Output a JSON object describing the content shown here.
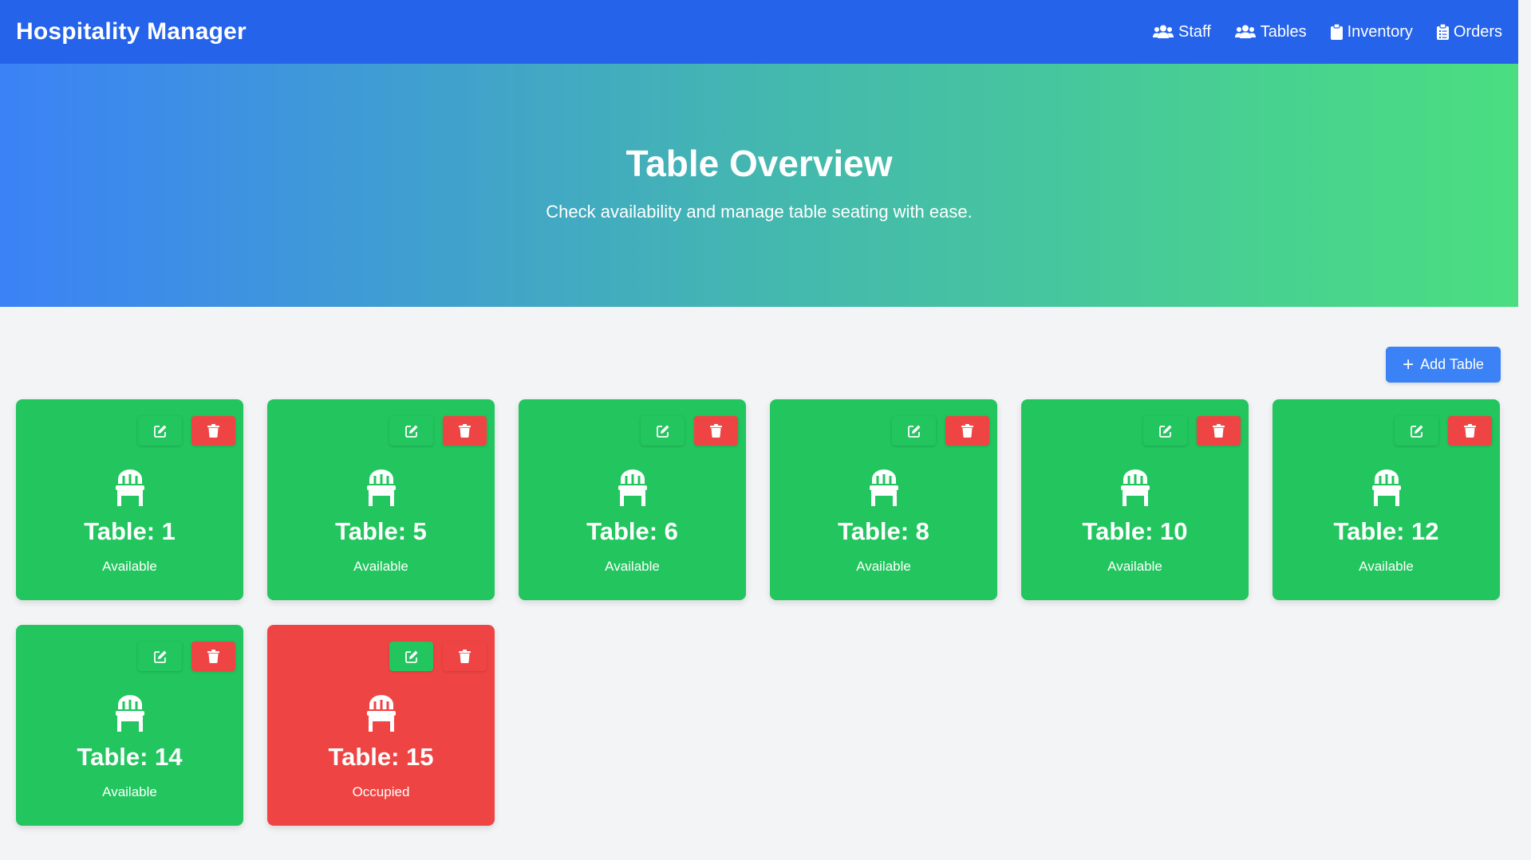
{
  "brand": "Hospitality Manager",
  "nav": [
    {
      "label": "Staff",
      "icon": "users-icon"
    },
    {
      "label": "Tables",
      "icon": "users-icon"
    },
    {
      "label": "Inventory",
      "icon": "clipboard-icon"
    },
    {
      "label": "Orders",
      "icon": "clipboard-list-icon"
    }
  ],
  "hero": {
    "title": "Table Overview",
    "subtitle": "Check availability and manage table seating with ease."
  },
  "add_button": {
    "label": "Add Table",
    "icon": "plus-icon"
  },
  "tables": [
    {
      "name": "Table: 1",
      "status": "Available"
    },
    {
      "name": "Table: 5",
      "status": "Available"
    },
    {
      "name": "Table: 6",
      "status": "Available"
    },
    {
      "name": "Table: 8",
      "status": "Available"
    },
    {
      "name": "Table: 10",
      "status": "Available"
    },
    {
      "name": "Table: 12",
      "status": "Available"
    },
    {
      "name": "Table: 14",
      "status": "Available"
    },
    {
      "name": "Table: 15",
      "status": "Occupied"
    }
  ],
  "colors": {
    "navbar": "#2563eb",
    "available": "#22c55e",
    "occupied": "#ef4444",
    "primary_button": "#3b82f6",
    "background": "#f3f4f6"
  }
}
